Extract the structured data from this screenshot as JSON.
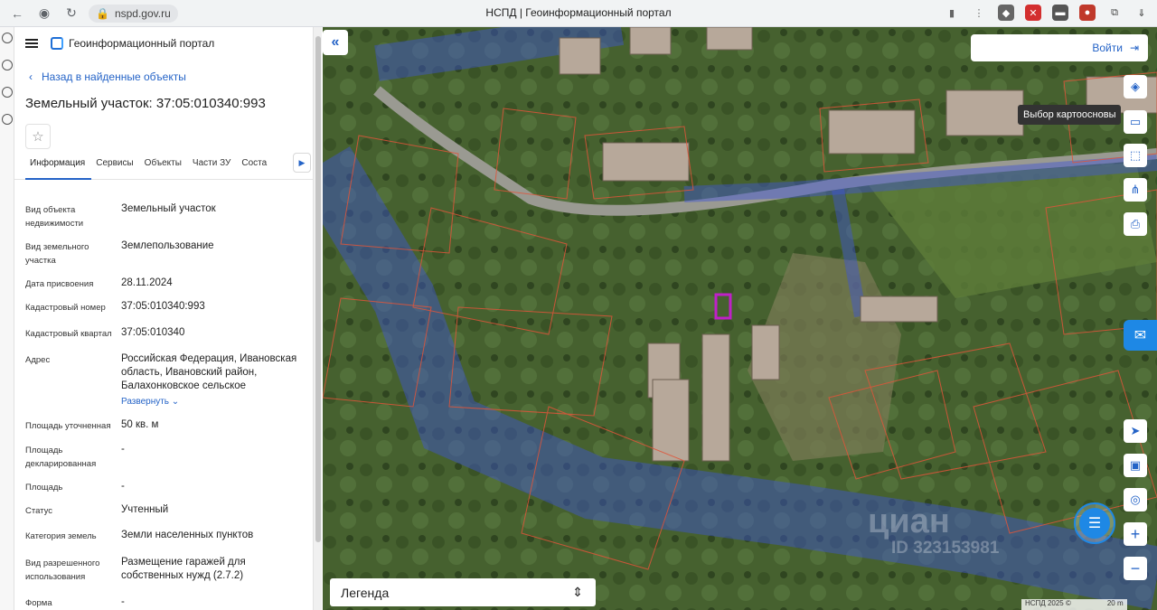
{
  "browser": {
    "url": "nspd.gov.ru",
    "page_title": "НСПД | Геоинформационный портал"
  },
  "app": {
    "title": "Геоинформационный портал",
    "back_label": "Назад в найденные объекты",
    "object_title": "Земельный участок: 37:05:010340:993",
    "tabs": [
      "Информация",
      "Сервисы",
      "Объекты",
      "Части ЗУ",
      "Соста"
    ],
    "active_tab": "Информация"
  },
  "attributes": [
    {
      "label": "Вид объекта недвижимости",
      "value": "Земельный участок"
    },
    {
      "label": "Вид земельного участка",
      "value": "Землепользование"
    },
    {
      "label": "Дата присвоения",
      "value": "28.11.2024"
    },
    {
      "label": "Кадастровый номер",
      "value": "37:05:010340:993"
    },
    {
      "label": "Кадастровый квартал",
      "value": "37:05:010340"
    },
    {
      "label": "Адрес",
      "value": "Российская Федерация, Ивановская область, Ивановский район, Балахонковское сельское",
      "expand_label": "Развернуть"
    },
    {
      "label": "Площадь уточненная",
      "value": "50 кв. м"
    },
    {
      "label": "Площадь декларированная",
      "value": "-"
    },
    {
      "label": "Площадь",
      "value": "-"
    },
    {
      "label": "Статус",
      "value": "Учтенный"
    },
    {
      "label": "Категория земель",
      "value": "Земли населенных пунктов"
    },
    {
      "label": "Вид разрешенного использования",
      "value": "Размещение гаражей для собственных нужд (2.7.2)"
    },
    {
      "label": "Форма собственности",
      "value": "-"
    }
  ],
  "map": {
    "login_label": "Войти",
    "tooltip": "Выбор картоосновы",
    "legend_label": "Легенда",
    "attribution": "НСПД 2025 ©",
    "scale": "20 m",
    "watermark": "циан",
    "watermark_id": "ID 323153981",
    "zone_color": "#3d55d6",
    "parcel_border_color": "#e0553a",
    "selected_parcel_color": "#c020c8"
  }
}
